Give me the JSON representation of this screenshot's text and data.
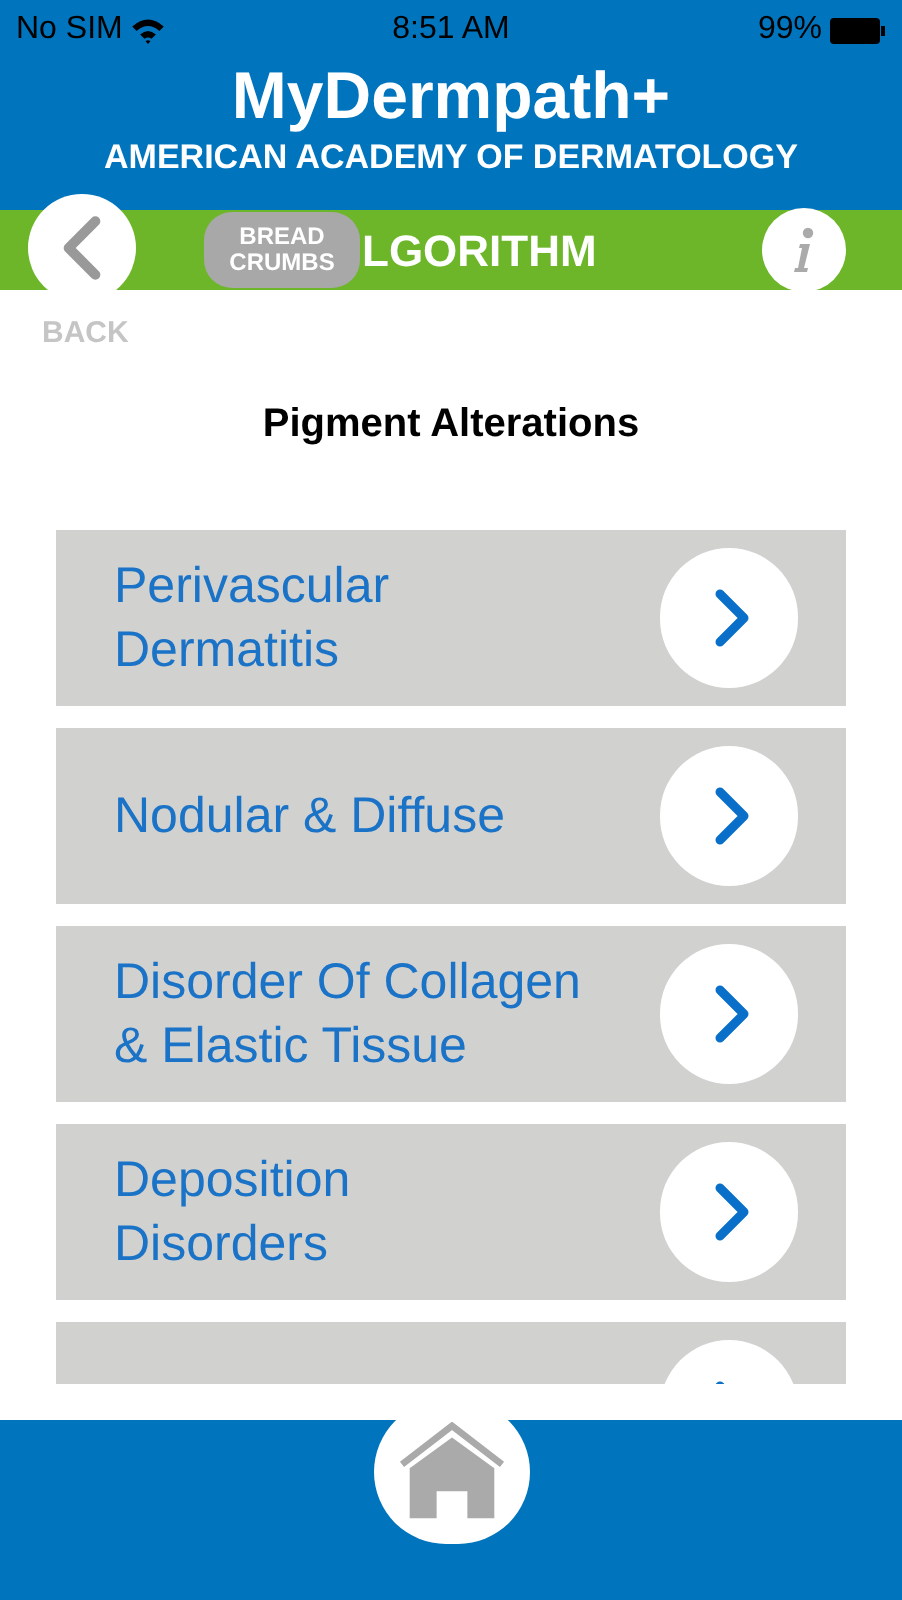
{
  "status_bar": {
    "carrier": "No SIM",
    "time": "8:51 AM",
    "battery": "99%"
  },
  "header": {
    "title": "MyDermpath+",
    "subtitle": "AMERICAN ACADEMY OF DERMATOLOGY"
  },
  "nav_bar": {
    "breadcrumbs": "BREAD CRUMBS",
    "title": "LGORITHM"
  },
  "back_label": "BACK",
  "page_title": "Pigment Alterations",
  "items": [
    {
      "kind": "category",
      "label": "Perivascular\nDermatitis"
    },
    {
      "kind": "category",
      "label": "Nodular & Diffuse"
    },
    {
      "kind": "category",
      "label": "Disorder Of Collagen\n& Elastic Tissue"
    },
    {
      "kind": "category",
      "label": "Deposition\nDisorders"
    },
    {
      "kind": "cut_off"
    }
  ]
}
